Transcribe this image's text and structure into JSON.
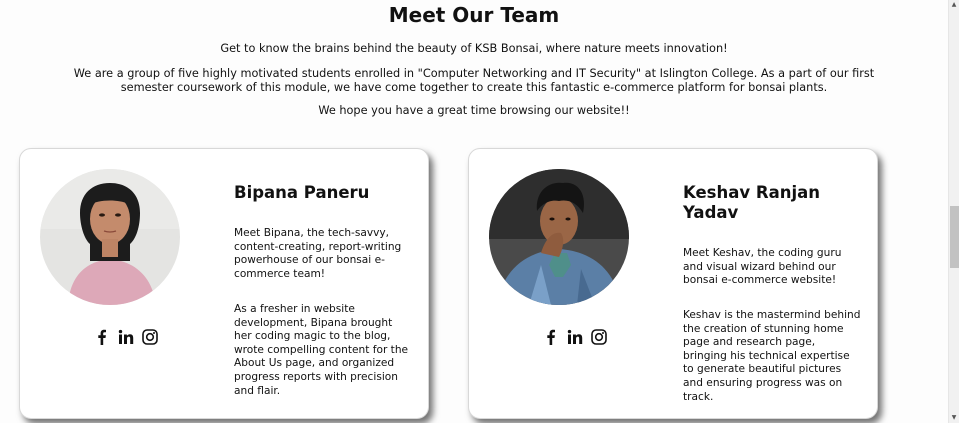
{
  "section": {
    "title": "Meet Our Team",
    "intro_1": "Get to know the brains behind the beauty of KSB Bonsai, where nature meets innovation!",
    "intro_2": "We are a group of five highly motivated students enrolled in \"Computer Networking and IT Security\" at Islington College. As a part of our first semester coursework of this module, we have come together to create this fantastic e-commerce platform for bonsai plants.",
    "intro_3": "We hope you have a great time browsing our website!!"
  },
  "team": [
    {
      "name": "Bipana Paneru",
      "bio_1": "Meet Bipana, the tech-savvy, content-creating, report-writing powerhouse of our bonsai e-commerce team!",
      "bio_2": "As a fresher in website development, Bipana brought her coding magic to the blog, wrote compelling content for the About Us page, and organized progress reports with precision and flair.",
      "socials": [
        "facebook-icon",
        "linkedin-icon",
        "instagram-icon"
      ]
    },
    {
      "name": "Keshav Ranjan Yadav",
      "bio_1": "Meet Keshav, the coding guru and visual wizard behind our bonsai e-commerce website!",
      "bio_2": "Keshav is the mastermind behind the creation of stunning home page and research page, bringing his technical expertise to generate beautiful pictures and ensuring progress was on track.",
      "socials": [
        "facebook-icon",
        "linkedin-icon",
        "instagram-icon"
      ]
    }
  ],
  "colors": {
    "text": "#111111",
    "card_bg": "#ffffff",
    "page_bg": "#fdfdfd"
  }
}
